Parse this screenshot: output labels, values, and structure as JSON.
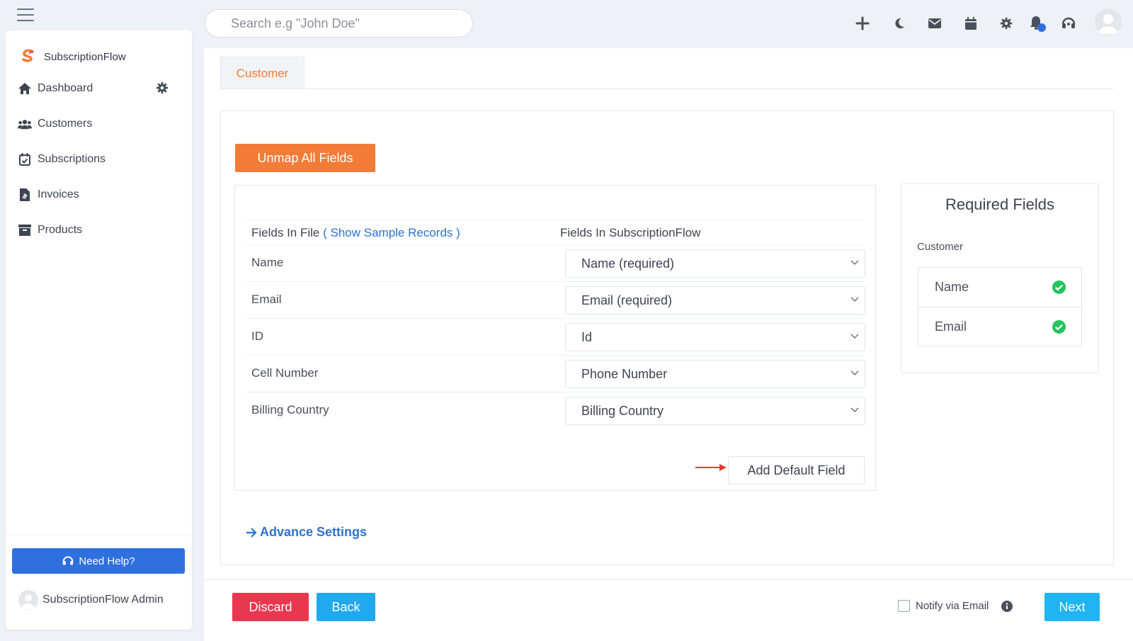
{
  "search": {
    "placeholder": "Search e.g \"John Doe\""
  },
  "brand": {
    "name": "SubscriptionFlow"
  },
  "sidebar": {
    "items": [
      {
        "label": "Dashboard",
        "icon": "home-icon"
      },
      {
        "label": "Customers",
        "icon": "users-icon"
      },
      {
        "label": "Subscriptions",
        "icon": "calendar-check-icon"
      },
      {
        "label": "Invoices",
        "icon": "invoice-icon"
      },
      {
        "label": "Products",
        "icon": "archive-icon"
      }
    ],
    "help_label": "Need Help?",
    "admin_name": "SubscriptionFlow Admin"
  },
  "topbar": {
    "icons": [
      "plus-icon",
      "moon-icon",
      "mail-icon",
      "calendar-icon",
      "gear-icon",
      "bell-icon",
      "headset-icon",
      "user-avatar"
    ]
  },
  "main": {
    "tab_label": "Customer",
    "unmap_label": "Unmap All Fields",
    "col_file": "Fields In File",
    "show_sample": "( Show Sample Records )",
    "col_sf": "Fields In SubscriptionFlow",
    "rows": [
      {
        "file_field": "Name",
        "mapped": "Name (required)"
      },
      {
        "file_field": "Email",
        "mapped": "Email (required)"
      },
      {
        "file_field": "ID",
        "mapped": "Id"
      },
      {
        "file_field": "Cell Number",
        "mapped": "Phone Number"
      },
      {
        "file_field": "Billing Country",
        "mapped": "Billing Country"
      }
    ],
    "add_default_label": "Add Default Field",
    "advance_label": "Advance Settings"
  },
  "required": {
    "title": "Required Fields",
    "subtitle": "Customer",
    "items": [
      "Name",
      "Email"
    ]
  },
  "footer": {
    "discard_label": "Discard",
    "back_label": "Back",
    "notify_label": "Notify via Email",
    "next_label": "Next"
  },
  "colors": {
    "accent_orange": "#f27b35",
    "link_blue": "#2b73d6",
    "discard_red": "#e8384f",
    "action_blue": "#20b4f2",
    "check_green": "#22c55e"
  }
}
